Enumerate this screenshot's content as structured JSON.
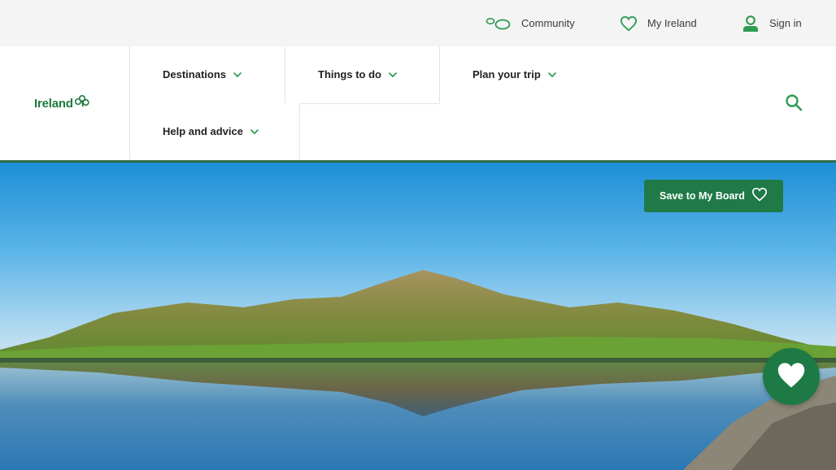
{
  "utility_bar": {
    "community_label": "Community",
    "my_ireland_label": "My Ireland",
    "sign_in_label": "Sign in"
  },
  "header": {
    "logo_text": "Ireland",
    "nav": [
      {
        "label": "Destinations"
      },
      {
        "label": "Things to do"
      },
      {
        "label": "Plan your trip"
      },
      {
        "label": "Help and advice"
      }
    ]
  },
  "hero": {
    "save_button_label": "Save to My Board"
  },
  "icons": {
    "community": "community-icon",
    "my_ireland": "heart-outline-icon",
    "sign_in": "person-icon",
    "search": "search-icon",
    "chevron": "chevron-down-icon",
    "favourites": "heart-filled-icon"
  },
  "colors": {
    "brand_green": "#1f7a47",
    "accent_green": "#2e9c52",
    "header_rule": "#2f6b47",
    "utility_bg": "#f4f4f4"
  }
}
